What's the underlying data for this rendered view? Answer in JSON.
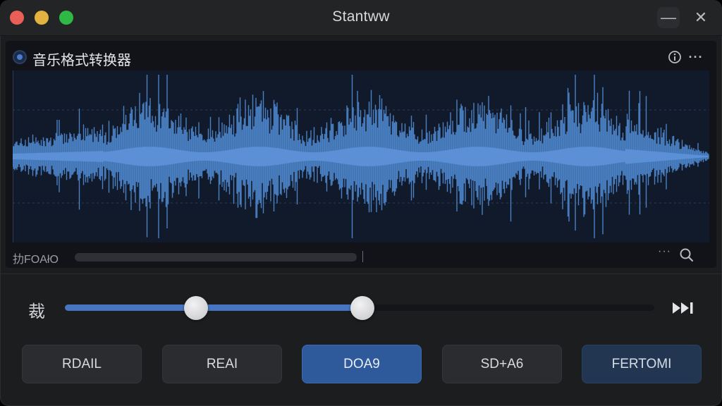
{
  "window": {
    "title": "Stantww",
    "minimize_glyph": "—",
    "close_glyph": "✕"
  },
  "panel": {
    "title": "音乐格式转换器",
    "info_icon": "info-icon",
    "more_glyph": "···",
    "footer_label": "扐FOAłO",
    "footer_more_glyph": "···",
    "progress": 0
  },
  "waveform": {
    "color": "#4a80c4",
    "background": "#111a2a"
  },
  "trim": {
    "label": "裁",
    "range_start": 0.223,
    "range_end": 0.505,
    "skip_icon": "skip-forward-icon"
  },
  "formats": [
    {
      "label": "RDAIL",
      "state": "normal"
    },
    {
      "label": "REAI",
      "state": "normal"
    },
    {
      "label": "DOA9",
      "state": "active"
    },
    {
      "label": "SD+A6",
      "state": "normal"
    },
    {
      "label": "FERTOMI",
      "state": "alt"
    }
  ],
  "colors": {
    "accent": "#4775c2",
    "active_button": "#2e5a9b"
  }
}
